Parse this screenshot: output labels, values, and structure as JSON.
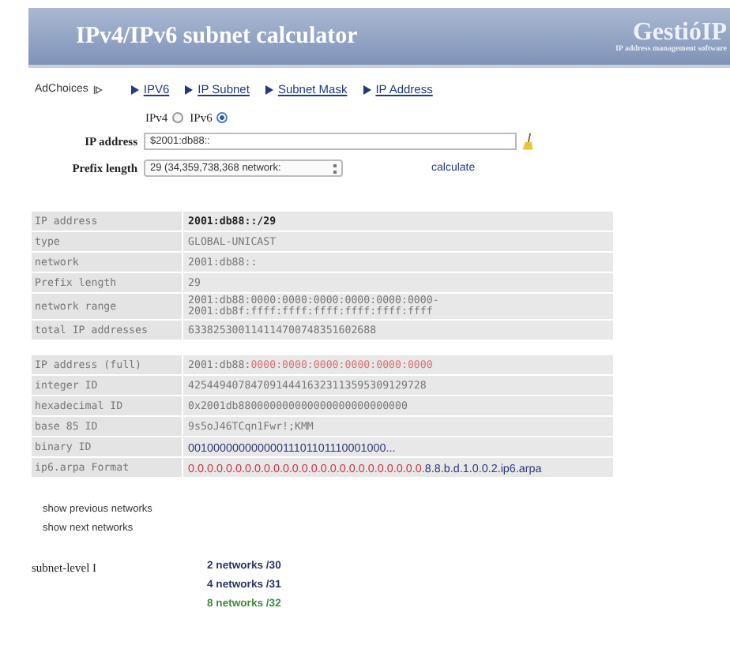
{
  "header": {
    "title": "IPv4/IPv6 subnet calculator",
    "brand": "GestióIP",
    "tagline": "IP address management software"
  },
  "ad_bar": {
    "label": "AdChoices",
    "links": [
      "IPV6",
      "IP Subnet",
      "Subnet Mask",
      "IP Address"
    ]
  },
  "version": [
    {
      "label": "IPv4",
      "selected": false
    },
    {
      "label": "IPv6",
      "selected": true
    }
  ],
  "form": {
    "ip_label": "IP address",
    "ip_value": "$2001:db88::",
    "prefix_label": "Prefix length",
    "prefix_value": "29 (34,359,738,368 network: ",
    "calculate": "calculate"
  },
  "table": [
    {
      "label": "IP address",
      "kind": "bold",
      "segments": [
        {
          "text": "2001:db88::/29",
          "color": "#222222"
        }
      ]
    },
    {
      "label": "type",
      "kind": "mono",
      "segments": [
        {
          "text": "GLOBAL-UNICAST",
          "color": "#777777"
        }
      ]
    },
    {
      "label": "network",
      "kind": "mono",
      "segments": [
        {
          "text": "2001:db88::",
          "color": "#777777"
        }
      ]
    },
    {
      "label": "Prefix length",
      "kind": "mono",
      "segments": [
        {
          "text": "29",
          "color": "#777777"
        }
      ]
    },
    {
      "label": "network range",
      "kind": "mono",
      "segments": [
        {
          "text": "2001:db88:0000:0000:0000:0000:0000:0000-2001:db8f:ffff:ffff:ffff:ffff:ffff:ffff",
          "color": "#777777"
        }
      ]
    },
    {
      "label": "total IP addresses",
      "kind": "mono",
      "segments": [
        {
          "text": "633825300114114700748351602688",
          "color": "#777777"
        }
      ]
    }
  ],
  "details": [
    {
      "label": "IP address (full)",
      "kind": "mono",
      "segments": [
        {
          "text": "2001:db88:",
          "color": "#777777"
        },
        {
          "text": "0000:0000:0000:0000:0000:0000",
          "color": "#d87070"
        }
      ]
    },
    {
      "label": "integer ID",
      "kind": "mono",
      "segments": [
        {
          "text": "42544940784709144416323113595309129728",
          "color": "#777777"
        }
      ]
    },
    {
      "label": "hexadecimal ID",
      "kind": "mono",
      "segments": [
        {
          "text": "0x2001db880000000000000000000000000",
          "color": "#777777"
        }
      ]
    },
    {
      "label": "base 85 ID",
      "kind": "mono",
      "segments": [
        {
          "text": "9s5oJ46TCqn1Fwr!;KMM",
          "color": "#777777"
        }
      ]
    },
    {
      "label": "binary ID",
      "kind": "sans",
      "segments": [
        {
          "text": "00100000000000011101101110001000...",
          "color": "#2a3a7a"
        }
      ]
    },
    {
      "label": "ip6.arpa Format",
      "kind": "sans",
      "segments": [
        {
          "text": "0.0.0.0.0.0.0.0.0.0.0.0.0.0.0.0.0.0.0.0.0.0.0.0.0.",
          "color": "#cc3344"
        },
        {
          "text": "8.8.b.d.1.0.0.2.ip6.arpa",
          "color": "#2a3a7a"
        }
      ]
    }
  ],
  "nav_links": [
    "show previous networks",
    "show next networks"
  ],
  "subnets": {
    "label": "subnet-level I",
    "items": [
      {
        "text": "2 networks /30",
        "color": "#2a3560"
      },
      {
        "text": "4 networks /31",
        "color": "#2a3560"
      },
      {
        "text": "8 networks /32",
        "color": "#3e8a3e"
      }
    ]
  }
}
